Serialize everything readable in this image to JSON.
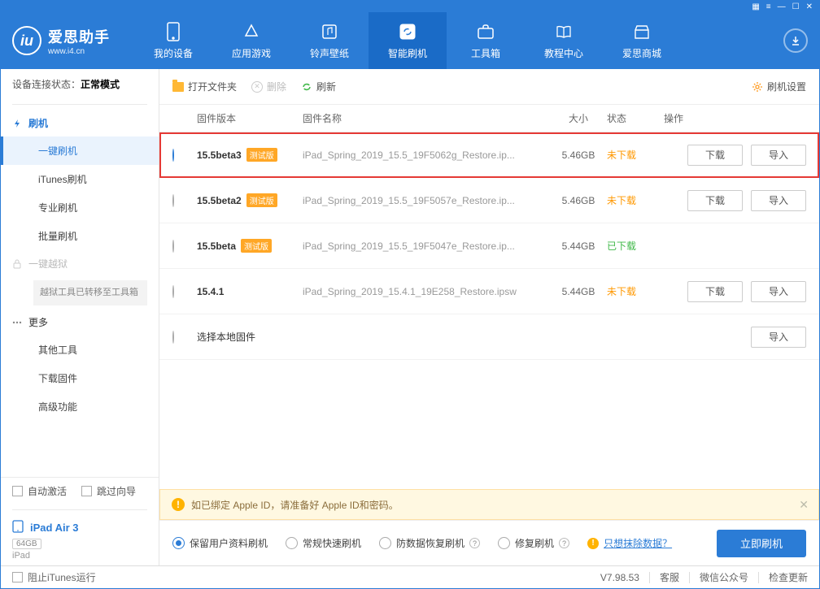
{
  "app": {
    "name": "爱思助手",
    "domain": "www.i4.cn"
  },
  "nav": [
    {
      "label": "我的设备"
    },
    {
      "label": "应用游戏"
    },
    {
      "label": "铃声壁纸"
    },
    {
      "label": "智能刷机"
    },
    {
      "label": "工具箱"
    },
    {
      "label": "教程中心"
    },
    {
      "label": "爱思商城"
    }
  ],
  "connection": {
    "prefix": "设备连接状态：",
    "mode": "正常模式"
  },
  "sidebar": {
    "flash": {
      "head": "刷机",
      "items": [
        "一键刷机",
        "iTunes刷机",
        "专业刷机",
        "批量刷机"
      ]
    },
    "jailbreak": {
      "head": "一键越狱",
      "note": "越狱工具已转移至工具箱"
    },
    "more": {
      "head": "更多",
      "items": [
        "其他工具",
        "下载固件",
        "高级功能"
      ]
    },
    "auto_activate": "自动激活",
    "skip_guide": "跳过向导"
  },
  "device": {
    "name": "iPad Air 3",
    "capacity": "64GB",
    "type": "iPad"
  },
  "toolbar": {
    "open_folder": "打开文件夹",
    "delete": "删除",
    "refresh": "刷新",
    "settings": "刷机设置"
  },
  "table": {
    "headers": {
      "version": "固件版本",
      "name": "固件名称",
      "size": "大小",
      "status": "状态",
      "ops": "操作"
    },
    "download_btn": "下载",
    "import_btn": "导入",
    "beta_tag": "测试版",
    "local_firmware": "选择本地固件",
    "rows": [
      {
        "version": "15.5beta3",
        "beta": true,
        "name": "iPad_Spring_2019_15.5_19F5062g_Restore.ip...",
        "size": "5.46GB",
        "status": "未下载",
        "status_cls": "not",
        "show_dl": true,
        "selected": true,
        "highlight": true
      },
      {
        "version": "15.5beta2",
        "beta": true,
        "name": "iPad_Spring_2019_15.5_19F5057e_Restore.ip...",
        "size": "5.46GB",
        "status": "未下载",
        "status_cls": "not",
        "show_dl": true,
        "selected": false
      },
      {
        "version": "15.5beta",
        "beta": true,
        "name": "iPad_Spring_2019_15.5_19F5047e_Restore.ip...",
        "size": "5.44GB",
        "status": "已下载",
        "status_cls": "done",
        "show_dl": false,
        "selected": false
      },
      {
        "version": "15.4.1",
        "beta": false,
        "name": "iPad_Spring_2019_15.4.1_19E258_Restore.ipsw",
        "size": "5.44GB",
        "status": "未下载",
        "status_cls": "not",
        "show_dl": true,
        "selected": false
      }
    ]
  },
  "notice": "如已绑定 Apple ID，请准备好 Apple ID和密码。",
  "flash_options": {
    "opts": [
      "保留用户资料刷机",
      "常规快速刷机",
      "防数据恢复刷机",
      "修复刷机"
    ],
    "erase_link": "只想抹除数据？",
    "action": "立即刷机"
  },
  "statusbar": {
    "block_itunes": "阻止iTunes运行",
    "version": "V7.98.53",
    "support": "客服",
    "wechat": "微信公众号",
    "update": "检查更新"
  }
}
